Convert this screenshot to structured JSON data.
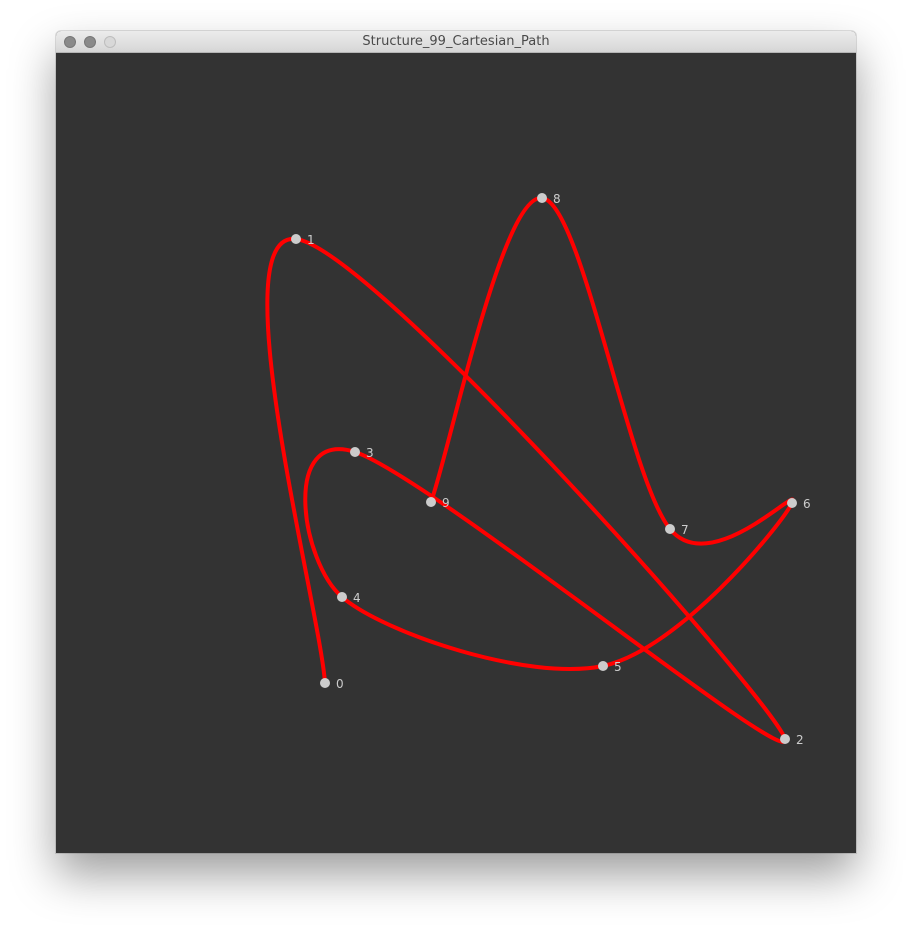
{
  "window": {
    "title": "Structure_99_Cartesian_Path"
  },
  "colors": {
    "canvas_bg": "#333333",
    "path": "#ff0000",
    "point": "#cccccc",
    "label": "#cccccc"
  },
  "chart_data": {
    "type": "line",
    "curve": "catmull-rom",
    "ylim": [
      0,
      800
    ],
    "xlim": [
      0,
      800
    ],
    "points": [
      {
        "label": "0",
        "x": 269,
        "y": 630
      },
      {
        "label": "1",
        "x": 240,
        "y": 186
      },
      {
        "label": "2",
        "x": 729,
        "y": 686
      },
      {
        "label": "3",
        "x": 299,
        "y": 399
      },
      {
        "label": "4",
        "x": 286,
        "y": 544
      },
      {
        "label": "5",
        "x": 547,
        "y": 613
      },
      {
        "label": "6",
        "x": 736,
        "y": 450
      },
      {
        "label": "7",
        "x": 614,
        "y": 476
      },
      {
        "label": "8",
        "x": 486,
        "y": 145
      },
      {
        "label": "9",
        "x": 375,
        "y": 449
      }
    ]
  }
}
